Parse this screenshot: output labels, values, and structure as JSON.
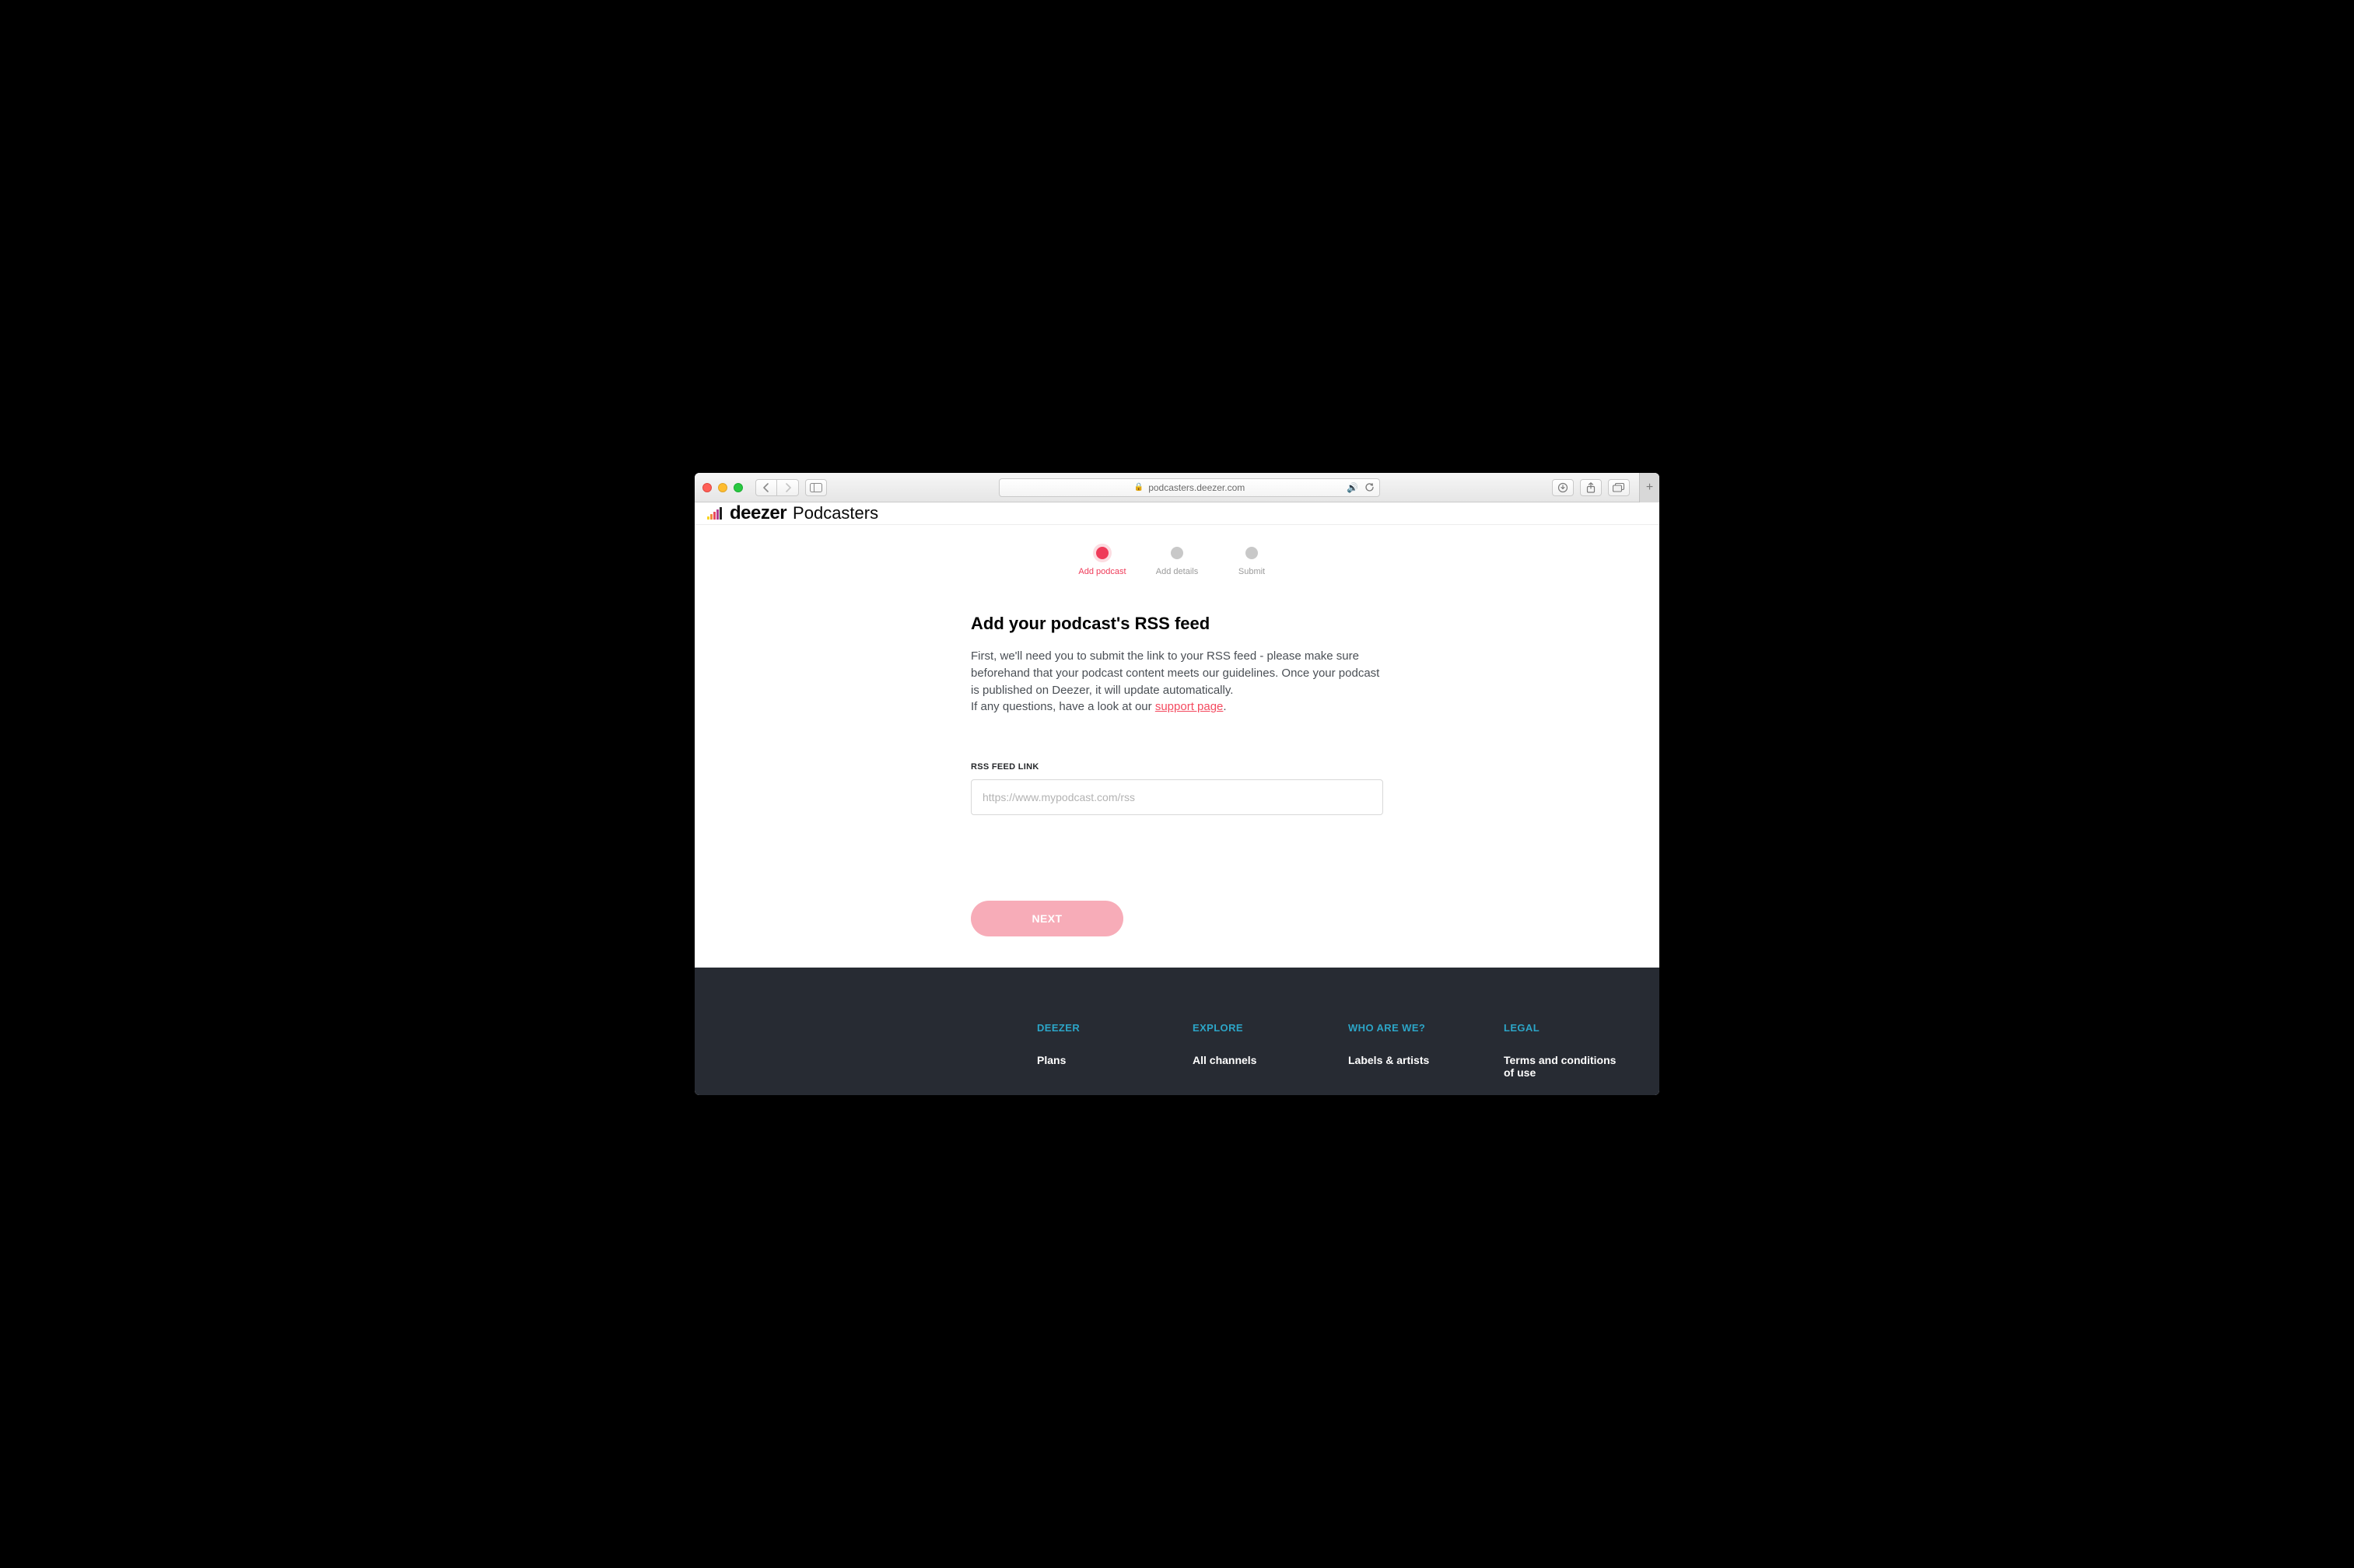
{
  "browser": {
    "url": "podcasters.deezer.com"
  },
  "header": {
    "brand": "deezer",
    "product": "Podcasters"
  },
  "stepper": {
    "steps": [
      {
        "label": "Add podcast",
        "active": true
      },
      {
        "label": "Add details",
        "active": false
      },
      {
        "label": "Submit",
        "active": false
      }
    ]
  },
  "main": {
    "heading": "Add your podcast's RSS feed",
    "body_1": "First, we'll need you to submit the link to your RSS feed - please make sure beforehand that your podcast content meets our guidelines. Once your podcast is published on Deezer, it will update automatically.",
    "body_2_prefix": "If any questions, have a look at our ",
    "support_link_text": "support page",
    "body_2_suffix": ".",
    "field_label": "RSS FEED LINK",
    "input_placeholder": "https://www.mypodcast.com/rss",
    "input_value": "",
    "next_label": "NEXT"
  },
  "footer": {
    "cols": [
      {
        "title": "DEEZER",
        "links": [
          "Plans"
        ]
      },
      {
        "title": "EXPLORE",
        "links": [
          "All channels"
        ]
      },
      {
        "title": "WHO ARE WE?",
        "links": [
          "Labels & artists"
        ]
      },
      {
        "title": "LEGAL",
        "links": [
          "Terms and conditions of use"
        ]
      }
    ]
  }
}
